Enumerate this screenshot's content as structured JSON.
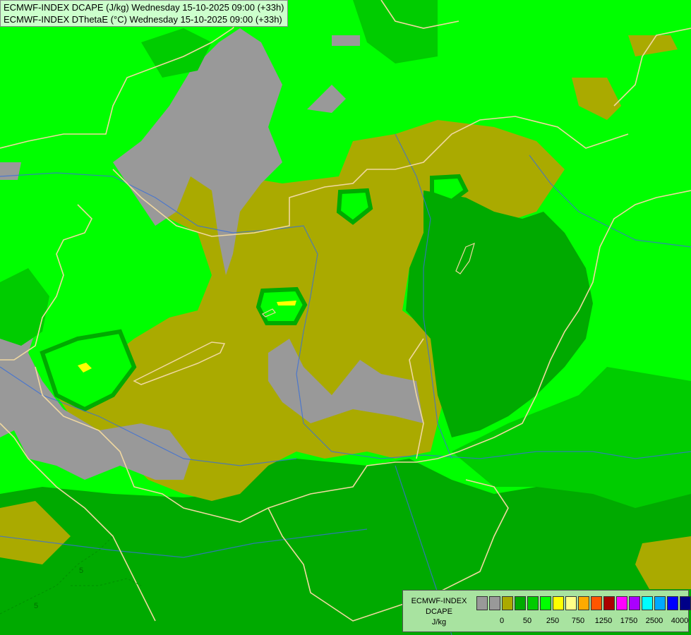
{
  "titles": {
    "line1": "ECMWF-INDEX DCAPE (J/kg) Wednesday 15-10-2025 09:00 (+33h)",
    "line2": "ECMWF-INDEX DThetaE (°C) Wednesday 15-10-2025 09:00 (+33h)"
  },
  "legend": {
    "title1": "ECMWF-INDEX",
    "title2": "DCAPE",
    "unit": "J/kg",
    "colors": [
      "#999999",
      "#999999",
      "#aaaa00",
      "#00aa00",
      "#00cc00",
      "#00ff00",
      "#ffff00",
      "#ffff88",
      "#ffaa00",
      "#ff5500",
      "#aa0000",
      "#ff00ff",
      "#aa00ff",
      "#00ffff",
      "#00aaff",
      "#0000ff",
      "#000088"
    ],
    "ticks": [
      "0",
      "50",
      "250",
      "750",
      "1250",
      "1750",
      "2500",
      "4000"
    ]
  },
  "palette": {
    "bright_green": "#00ff00",
    "mid_green": "#00cc00",
    "dark_green": "#00aa00",
    "olive": "#aaaa00",
    "gray": "#999999",
    "yellow": "#ffff00",
    "border": "#f0d8a0",
    "river": "#3a6fd8"
  },
  "map_labels": {
    "contour_a": "5",
    "contour_b": "5"
  }
}
